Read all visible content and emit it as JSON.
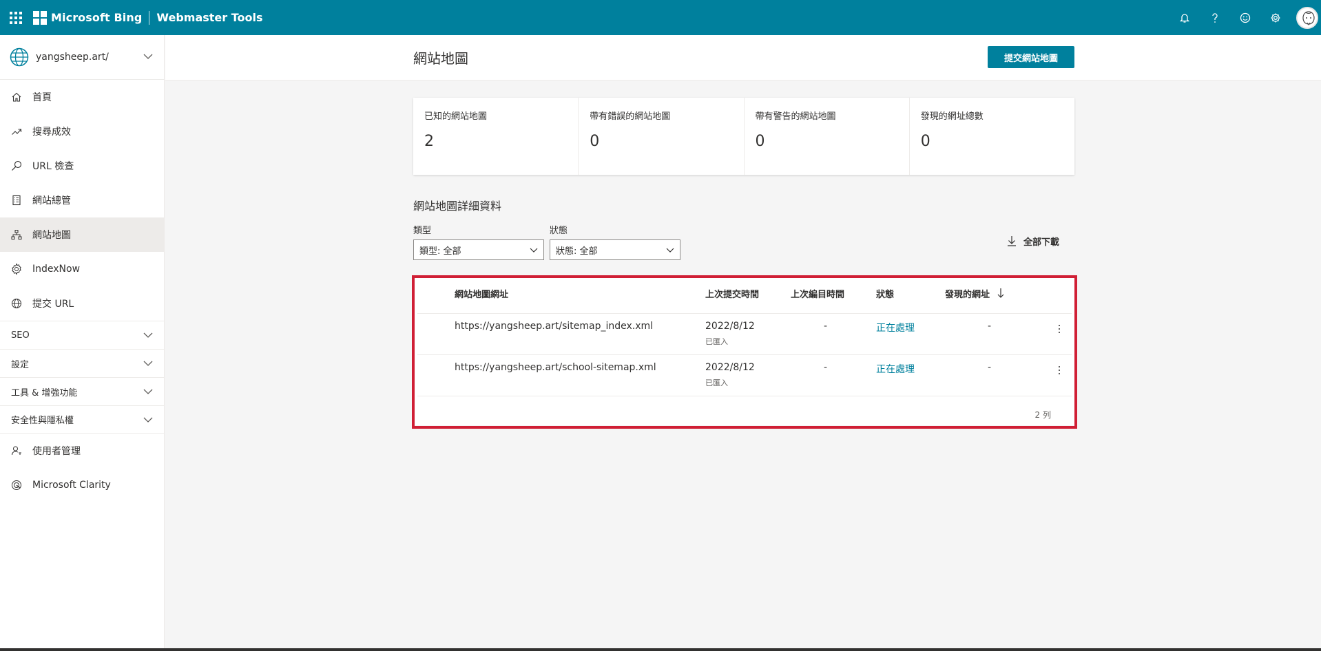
{
  "topbar": {
    "brand": "Microsoft Bing",
    "product": "Webmaster Tools",
    "icons": [
      "waffle-icon",
      "bell-icon",
      "help-icon",
      "smiley-icon",
      "gear-icon",
      "avatar"
    ]
  },
  "sidebar": {
    "site": "yangsheep.art/",
    "items": [
      {
        "label": "首頁",
        "icon": "home-icon"
      },
      {
        "label": "搜尋成效",
        "icon": "trend-icon"
      },
      {
        "label": "URL 檢查",
        "icon": "search-icon"
      },
      {
        "label": "網站總管",
        "icon": "document-icon"
      },
      {
        "label": "網站地圖",
        "icon": "sitemap-icon",
        "active": true
      },
      {
        "label": "IndexNow",
        "icon": "gear-icon"
      },
      {
        "label": "提交 URL",
        "icon": "globe-icon"
      }
    ],
    "groups": [
      "SEO",
      "設定",
      "工具 & 增強功能",
      "安全性與隱私權"
    ],
    "bottom_items": [
      {
        "label": "使用者管理",
        "icon": "user-icon"
      },
      {
        "label": "Microsoft Clarity",
        "icon": "clarity-icon"
      }
    ]
  },
  "page": {
    "title": "網站地圖",
    "submit_button": "提交網站地圖"
  },
  "cards": [
    {
      "label": "已知的網站地圖",
      "value": "2"
    },
    {
      "label": "帶有錯誤的網站地圖",
      "value": "0"
    },
    {
      "label": "帶有警告的網站地圖",
      "value": "0"
    },
    {
      "label": "發現的網址總數",
      "value": "0"
    }
  ],
  "details": {
    "title": "網站地圖詳細資料",
    "type_label": "類型",
    "type_value": "類型: 全部",
    "status_label": "狀態",
    "status_value": "狀態: 全部",
    "download": "全部下載"
  },
  "table": {
    "headers": {
      "url": "網站地圖網址",
      "last_submitted": "上次提交時間",
      "last_crawled": "上次編目時間",
      "status": "狀態",
      "discovered": "發現的網址"
    },
    "rows": [
      {
        "url": "https://yangsheep.art/sitemap_index.xml",
        "date": "2022/8/12",
        "sub": "已匯入",
        "crawled": "-",
        "status": "正在處理",
        "discovered": "-"
      },
      {
        "url": "https://yangsheep.art/school-sitemap.xml",
        "date": "2022/8/12",
        "sub": "已匯入",
        "crawled": "-",
        "status": "正在處理",
        "discovered": "-"
      }
    ],
    "row_count": "2 列"
  },
  "colors": {
    "accent": "#00809d",
    "highlight": "#d01f35"
  }
}
